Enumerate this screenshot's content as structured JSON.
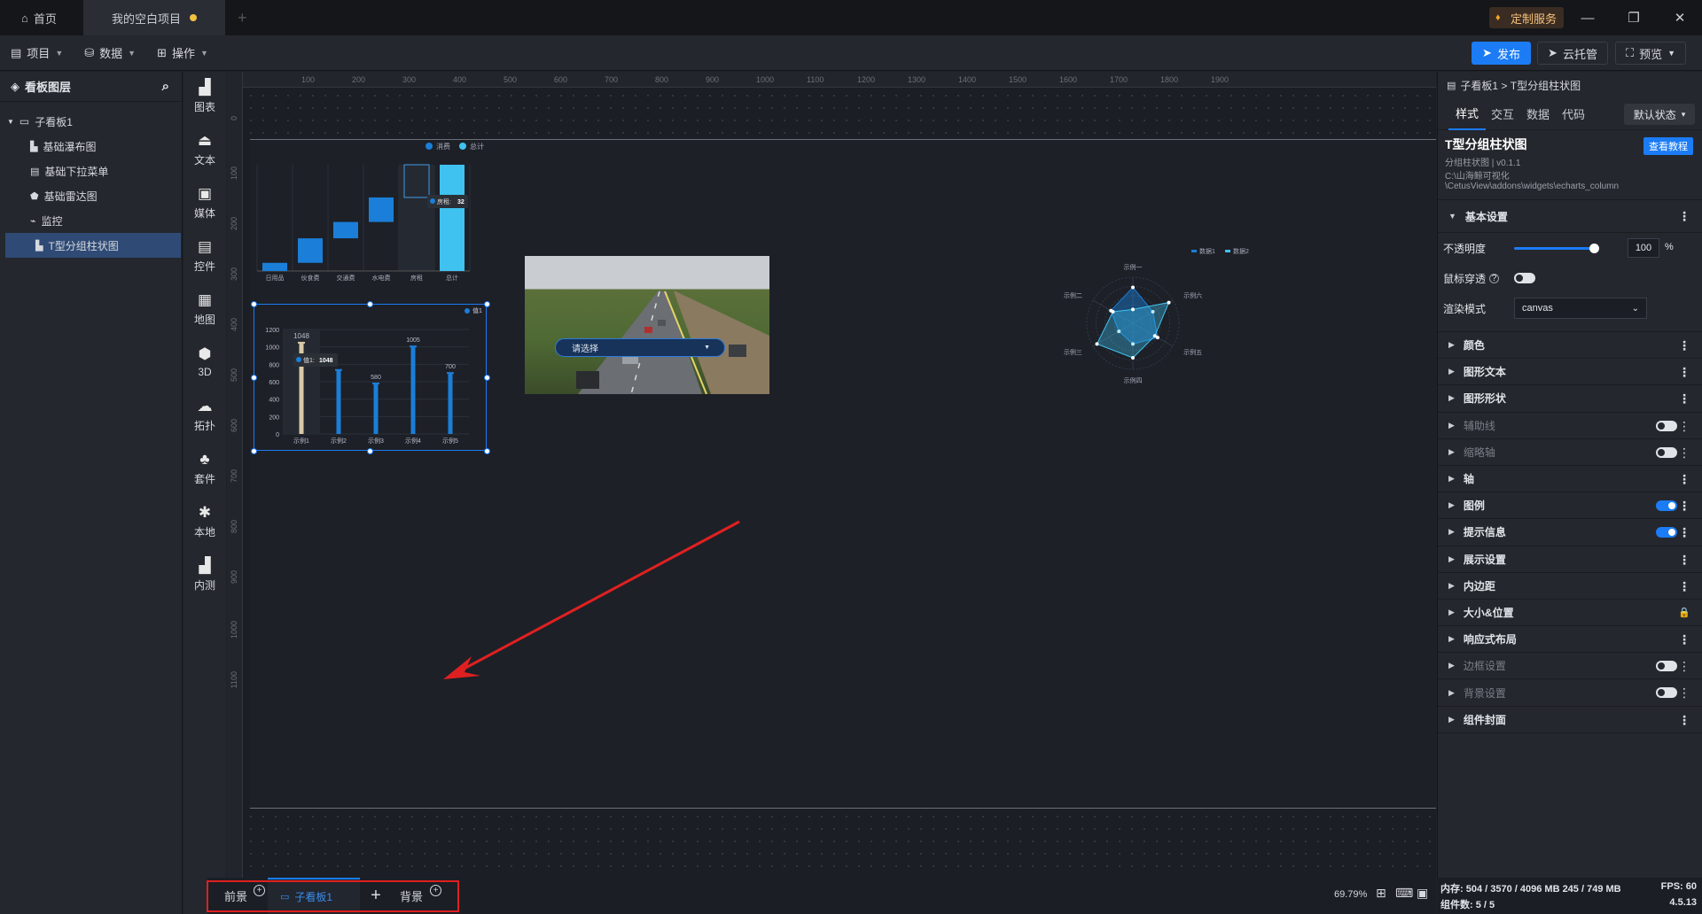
{
  "titlebar": {
    "home_tab": "首页",
    "project_tab": "我的空白项目",
    "custom_service": "定制服务"
  },
  "menubar": {
    "project": "项目",
    "data": "数据",
    "operate": "操作",
    "publish": "发布",
    "cloud_host": "云托管",
    "preview": "预览"
  },
  "layers": {
    "title": "看板图层",
    "root": "子看板1",
    "items": [
      "基础瀑布图",
      "基础下拉菜单",
      "基础雷达图",
      "监控",
      "T型分组柱状图"
    ]
  },
  "tools": [
    "图表",
    "文本",
    "媒体",
    "控件",
    "地图",
    "3D",
    "拓扑",
    "套件",
    "本地",
    "内测"
  ],
  "ruler": {
    "h": [
      "100",
      "200",
      "300",
      "400",
      "500",
      "600",
      "700",
      "800",
      "900",
      "1000",
      "1100",
      "1200",
      "1300",
      "1400",
      "1500",
      "1600",
      "1700",
      "1800",
      "1900"
    ],
    "v": [
      "0",
      "100",
      "200",
      "300",
      "400",
      "500",
      "600",
      "700",
      "800",
      "900",
      "1000",
      "1100"
    ]
  },
  "chart_data": [
    {
      "type": "bar",
      "legend": [
        "消费",
        "总计"
      ],
      "categories": [
        "日用品",
        "伙食费",
        "交通费",
        "水电费",
        "房租",
        "总计"
      ],
      "series": [
        {
          "name": "消费",
          "values": [
            100,
            300,
            200,
            300,
            400,
            1300
          ]
        }
      ],
      "tooltip": {
        "label": "房租:",
        "value": "32"
      }
    },
    {
      "type": "bar",
      "legend": [
        "值1"
      ],
      "categories": [
        "示例1",
        "示例2",
        "示例3",
        "示例4",
        "示例5"
      ],
      "series": [
        {
          "name": "值1",
          "values": [
            1048,
            735,
            580,
            1005,
            700
          ]
        }
      ],
      "data_labels": [
        "1048",
        "",
        "580",
        "1005",
        "700"
      ],
      "yticks": [
        "0",
        "200",
        "400",
        "600",
        "800",
        "1000",
        "1200"
      ],
      "ylim": [
        0,
        1200
      ],
      "tooltip": {
        "label": "值1:",
        "value": "1048"
      }
    },
    {
      "type": "radar",
      "legend": [
        "数据1",
        "数据2"
      ],
      "indicators": [
        "示例一",
        "示例六",
        "示例五",
        "示例四",
        "示例三",
        "示例二"
      ],
      "series": [
        {
          "name": "数据1",
          "values": [
            0.78,
            0.5,
            0.62,
            0.45,
            0.35,
            0.55
          ]
        },
        {
          "name": "数据2",
          "values": [
            0.3,
            0.9,
            0.55,
            0.75,
            0.9,
            0.5
          ]
        }
      ]
    }
  ],
  "dropdown_widget": {
    "label": "请选择"
  },
  "bottomtabs": {
    "front": "前景",
    "board": "子看板1",
    "back": "背景",
    "zoom": "69.79%"
  },
  "props": {
    "breadcrumb": "子看板1 > T型分组柱状图",
    "tabs": [
      "样式",
      "交互",
      "数据",
      "代码"
    ],
    "state_select": "默认状态",
    "component_title": "T型分组柱状图",
    "tutorial_button": "查看教程",
    "component_sub": "分组柱状图 | v0.1.1",
    "component_path1": "C:\\山海鲸可视化",
    "component_path2": "\\CetusView\\addons\\widgets\\echarts_column",
    "basic_settings": "基本设置",
    "opacity_label": "不透明度",
    "opacity_value": "100",
    "opacity_unit": "%",
    "opacity_fraction": 1.0,
    "mouse_through": "鼠标穿透",
    "render_mode": "渲染模式",
    "render_value": "canvas",
    "sections": [
      {
        "label": "颜色",
        "dim": false
      },
      {
        "label": "图形文本",
        "dim": false
      },
      {
        "label": "图形形状",
        "dim": false
      },
      {
        "label": "辅助线",
        "dim": true
      },
      {
        "label": "缩略轴",
        "dim": true
      },
      {
        "label": "轴",
        "dim": false
      },
      {
        "label": "图例",
        "dim": false
      },
      {
        "label": "提示信息",
        "dim": false
      },
      {
        "label": "展示设置",
        "dim": false
      },
      {
        "label": "内边距",
        "dim": false
      },
      {
        "label": "大小&位置",
        "dim": false
      },
      {
        "label": "响应式布局",
        "dim": false
      },
      {
        "label": "边框设置",
        "dim": true
      },
      {
        "label": "背景设置",
        "dim": true
      },
      {
        "label": "组件封面",
        "dim": false
      }
    ]
  },
  "status": {
    "memory": "内存:  504 / 3570 / 4096 MB  245 / 749 MB",
    "fps": "FPS:  60",
    "components": "组件数: 5 / 5",
    "version": "4.5.13"
  },
  "colors": {
    "accent": "#1b7cf5",
    "annotation": "#e02020",
    "bar_blue": "#1b7ed8",
    "bar_cyan": "#3fc2f0",
    "bar_hl": "#d9c9a6"
  }
}
